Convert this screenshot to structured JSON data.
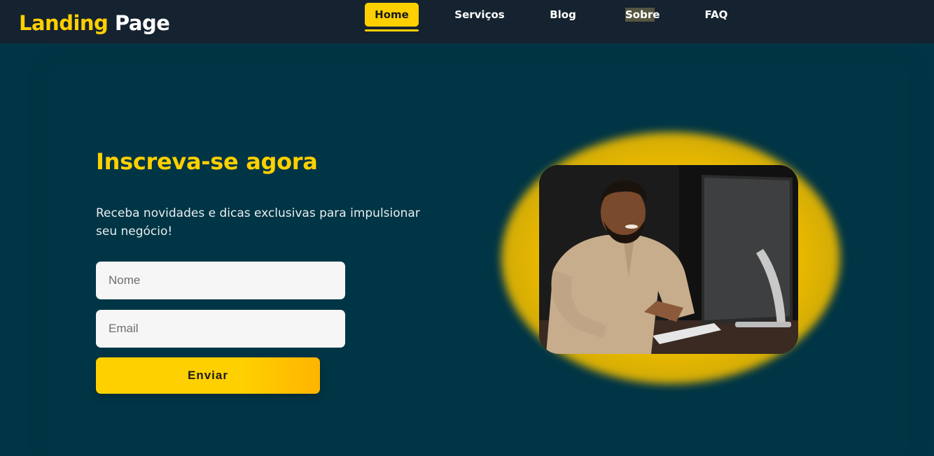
{
  "brand": {
    "part1": "Landing",
    "part2": "Page"
  },
  "nav": {
    "home": "Home",
    "servicos": "Serviços",
    "blog": "Blog",
    "sobre": "Sobre",
    "faq": "FAQ"
  },
  "hero": {
    "title": "Inscreva-se agora",
    "subtitle": "Receba novidades e dicas exclusivas para impulsionar seu negócio!",
    "form": {
      "name_placeholder": "Nome",
      "email_placeholder": "Email",
      "submit_label": "Enviar"
    }
  },
  "colors": {
    "accent": "#ffd000",
    "nav_bg": "#15222f",
    "hero_bg": "#003545"
  }
}
